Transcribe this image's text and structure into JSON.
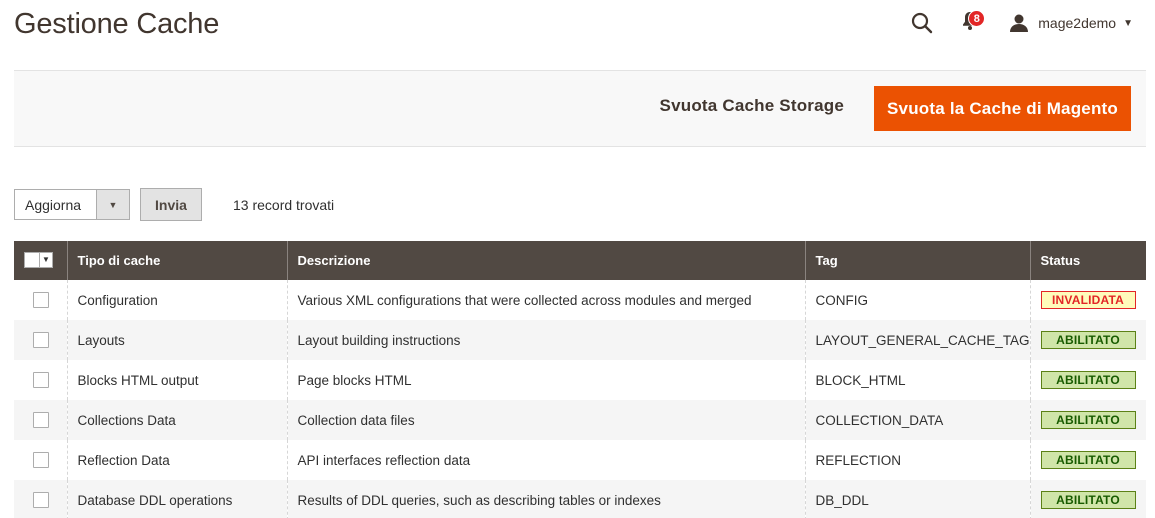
{
  "page": {
    "title": "Gestione Cache"
  },
  "header": {
    "notifications_count": "8",
    "user_name": "mage2demo"
  },
  "actions": {
    "flush_storage_label": "Svuota Cache Storage",
    "flush_magento_label": "Svuota la Cache di Magento"
  },
  "mass_action": {
    "selected": "Aggiorna",
    "submit_label": "Invia",
    "records_found": "13 record trovati"
  },
  "grid": {
    "columns": [
      "Tipo di cache",
      "Descrizione",
      "Tag",
      "Status"
    ],
    "rows": [
      {
        "type": "Configuration",
        "description": "Various XML configurations that were collected across modules and merged",
        "tag": "CONFIG",
        "status": "INVALIDATA",
        "status_kind": "invalid"
      },
      {
        "type": "Layouts",
        "description": "Layout building instructions",
        "tag": "LAYOUT_GENERAL_CACHE_TAG",
        "status": "ABILITATO",
        "status_kind": "enabled"
      },
      {
        "type": "Blocks HTML output",
        "description": "Page blocks HTML",
        "tag": "BLOCK_HTML",
        "status": "ABILITATO",
        "status_kind": "enabled"
      },
      {
        "type": "Collections Data",
        "description": "Collection data files",
        "tag": "COLLECTION_DATA",
        "status": "ABILITATO",
        "status_kind": "enabled"
      },
      {
        "type": "Reflection Data",
        "description": "API interfaces reflection data",
        "tag": "REFLECTION",
        "status": "ABILITATO",
        "status_kind": "enabled"
      },
      {
        "type": "Database DDL operations",
        "description": "Results of DDL queries, such as describing tables or indexes",
        "tag": "DB_DDL",
        "status": "ABILITATO",
        "status_kind": "enabled"
      }
    ]
  },
  "colors": {
    "accent": "#eb5202",
    "header_bg": "#514943",
    "invalid": "#e22626",
    "enabled_bg": "#d0e5a9"
  }
}
